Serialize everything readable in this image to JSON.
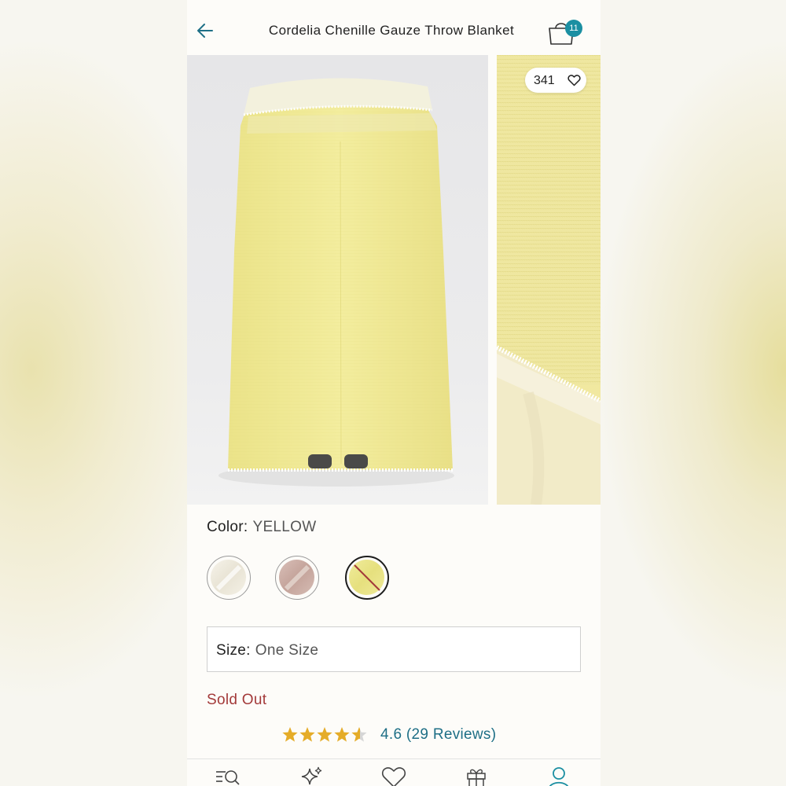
{
  "header": {
    "title": "Cordelia Chenille Gauze Throw Blanket",
    "back_icon": "arrow-left-icon",
    "bag_icon": "shopping-bag-icon",
    "bag_count": "11"
  },
  "gallery": {
    "likes_count": "341",
    "likes_icon": "heart-outline-icon"
  },
  "color": {
    "label": "Color:",
    "value": "YELLOW",
    "swatches": [
      {
        "name": "ivory",
        "color": "#f1ede3",
        "selected": false,
        "available": true
      },
      {
        "name": "mauve",
        "color": "#cfb3ac",
        "selected": false,
        "available": true
      },
      {
        "name": "yellow",
        "color": "#ece88d",
        "selected": true,
        "available": false
      }
    ]
  },
  "size": {
    "label": "Size:",
    "value": "One Size"
  },
  "availability": "Sold Out",
  "rating": {
    "stars": 4.6,
    "text": "4.6 (29 Reviews)"
  },
  "tabbar": {
    "icons": [
      "search-list-icon",
      "sparkles-icon",
      "heart-icon",
      "gift-icon",
      "account-icon"
    ]
  },
  "colors": {
    "accent": "#1b8fa2",
    "sold_out": "#a33a3a",
    "star": "#e5ac28",
    "blanket": "#ece88d"
  }
}
